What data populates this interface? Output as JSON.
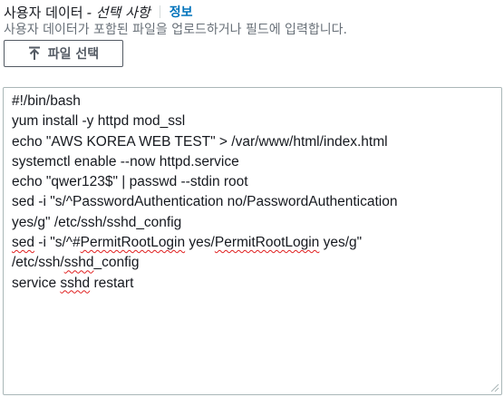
{
  "field": {
    "label": "사용자 데이터",
    "optional": "- 선택 사항",
    "info_link": "정보",
    "description": "사용자 데이터가 포함된 파일을 업로드하거나 필드에 입력합니다.",
    "file_button_label": "파일 선택",
    "file_button_icon": "upload-icon"
  },
  "editor": {
    "lines": [
      [
        "#!/bin/bash"
      ],
      [
        "yum install -y httpd mod_ssl"
      ],
      [
        "echo \"AWS KOREA WEB TEST\" > /var/www/html/index.html"
      ],
      [
        "systemctl enable --now httpd.service"
      ],
      [
        "echo \"qwer123$\" | passwd --stdin root"
      ],
      [
        "sed -i \"s/^PasswordAuthentication no/PasswordAuthentication"
      ],
      [
        "yes/g\" /etc/ssh/sshd_config"
      ],
      [
        "sed",
        " -i \"s/^#",
        "PermitRootLogin",
        " yes/",
        "PermitRootLogin",
        " yes/g\""
      ],
      [
        "/etc/ssh/",
        "sshd",
        "_config"
      ],
      [
        "service ",
        "sshd",
        " restart"
      ]
    ]
  }
}
